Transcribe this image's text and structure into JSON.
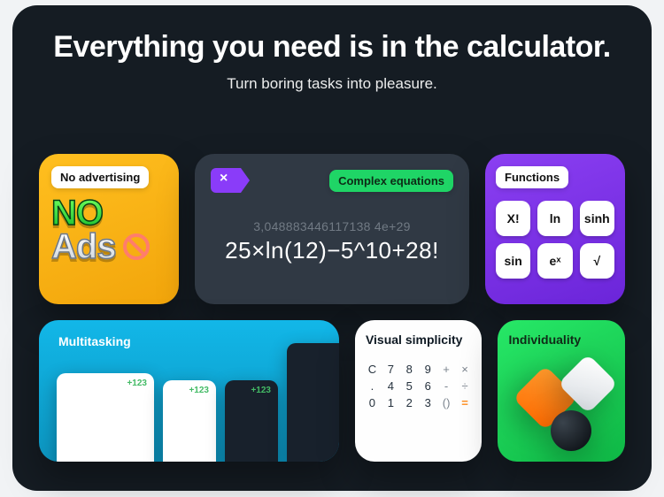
{
  "hero": {
    "title": "Everything you need is in the calculator.",
    "subtitle": "Turn boring tasks into pleasure."
  },
  "cards": {
    "ads": {
      "pill": "No advertising",
      "word1": "NO",
      "word2": "Ads"
    },
    "equation": {
      "badge": "Complex equations",
      "delete_glyph": "×",
      "result": "3,048883446117138 4e+29",
      "expression": "25×ln(12)−5^10+28!"
    },
    "functions": {
      "pill": "Functions",
      "keys": [
        "X!",
        "ln",
        "sinh",
        "sin",
        "eˣ",
        "√"
      ]
    },
    "multitasking": {
      "label": "Multitasking",
      "sum": "+123"
    },
    "visual": {
      "label": "Visual simplicity",
      "rows": [
        [
          "C",
          "7",
          "8",
          "9",
          "+",
          "×"
        ],
        [
          ".",
          "4",
          "5",
          "6",
          "-",
          "÷"
        ],
        [
          "0",
          "1",
          "2",
          "3",
          "()",
          "="
        ]
      ]
    },
    "individuality": {
      "label": "Individuality"
    }
  }
}
